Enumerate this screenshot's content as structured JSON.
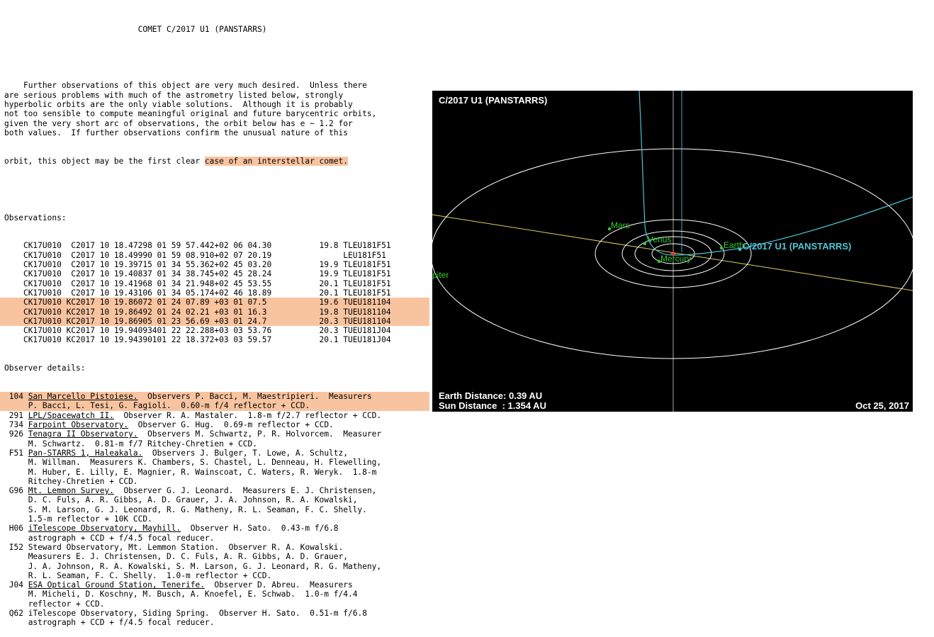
{
  "document": {
    "title": "COMET C/2017 U1 (PANSTARRS)",
    "paragraph": [
      "Further observations of this object are very much desired.  Unless there",
      "are serious problems with much of the astrometry listed below, strongly",
      "hyperbolic orbits are the only viable solutions.  Although it is probably",
      "not too sensible to compute meaningful original and future barycentric orbits,",
      "given the very short arc of observations, the orbit below has e ~ 1.2 for",
      "both values.  If further observations confirm the unusual nature of this"
    ],
    "paragraph_last_prefix": "orbit, this object may be the first clear ",
    "paragraph_last_highlight": "case of an interstellar comet.",
    "observations_heading": "Observations:",
    "observations": [
      "CK17U010  C2017 10 18.47298 01 59 57.442+02 06 04.30          19.8 TLEU181F51",
      "CK17U010  C2017 10 18.49990 01 59 08.910+02 07 20.19               LEU181F51",
      "CK17U010  C2017 10 19.39715 01 34 55.362+02 45 03.20          19.9 TLEU181F51",
      "CK17U010  C2017 10 19.40837 01 34 38.745+02 45 28.24          19.9 TLEU181F51",
      "CK17U010  C2017 10 19.41968 01 34 21.948+02 45 53.55          20.1 TLEU181F51",
      "CK17U010  C2017 10 19.43106 01 34 05.174+02 46 18.89          20.1 TLEU181F51",
      "CK17U010 KC2017 10 19.86072 01 24 07.89 +03 01 07.5           19.6 TUEU181104",
      "CK17U010 KC2017 10 19.86492 01 24 02.21 +03 01 16.3           19.8 TUEU181104",
      "CK17U010 KC2017 10 19.86905 01 23 56.69 +03 01 24.7           20.3 TUEU181104",
      "CK17U010 KC2017 10 19.94093401 22 22.288+03 03 53.76          20.3 TUEU181J04",
      "CK17U010 KC2017 10 19.94390101 22 18.372+03 03 59.57          20.1 TUEU181J04"
    ],
    "observer_heading": "Observer details:",
    "observers": [
      {
        "code": "104",
        "site": "San Marcello Pistoiese.",
        "text": "  Observers P. Bacci, M. Maestripieri.  Measurers",
        "cont": [
          "P. Bacci, L. Tesi, G. Fagioli.  0.60-m f/4 reflector + CCD."
        ]
      },
      {
        "code": "291",
        "site": "LPL/Spacewatch II.",
        "text": "  Observer R. A. Mastaler.  1.8-m f/2.7 reflector + CCD.",
        "cont": []
      },
      {
        "code": "734",
        "site": "Farpoint Observatory.",
        "text": "  Observer G. Hug.  0.69-m reflector + CCD.",
        "cont": []
      },
      {
        "code": "926",
        "site": "Tenagra II Observatory.",
        "text": "  Observers M. Schwartz, P. R. Holvorcem.  Measurer",
        "cont": [
          "M. Schwartz.  0.81-m f/7 Ritchey-Chretien + CCD."
        ]
      },
      {
        "code": "F51",
        "site": "Pan-STARRS 1, Haleakala.",
        "text": "  Observers J. Bulger, T. Lowe, A. Schultz,",
        "cont": [
          "M. Willman.  Measurers K. Chambers, S. Chastel, L. Denneau, H. Flewelling,",
          "M. Huber, E. Lilly, E. Magnier, R. Wainscoat, C. Waters, R. Weryk.  1.8-m",
          "Ritchey-Chretien + CCD."
        ]
      },
      {
        "code": "G96",
        "site": "Mt. Lemmon Survey.",
        "text": "  Observer G. J. Leonard.  Measurers E. J. Christensen,",
        "cont": [
          "D. C. Fuls, A. R. Gibbs, A. D. Grauer, J. A. Johnson, R. A. Kowalski,",
          "S. M. Larson, G. J. Leonard, R. G. Matheny, R. L. Seaman, F. C. Shelly.",
          "1.5-m reflector + 10K CCD."
        ]
      },
      {
        "code": "H06",
        "site": "iTelescope Observatory, Mayhill.",
        "text": "  Observer H. Sato.  0.43-m f/6.8",
        "cont": [
          "astrograph + CCD + f/4.5 focal reducer."
        ]
      },
      {
        "code": "I52",
        "site": "",
        "text": "Steward Observatory, Mt. Lemmon Station.  Observer R. A. Kowalski.",
        "cont": [
          "Measurers E. J. Christensen, D. C. Fuls, A. R. Gibbs, A. D. Grauer,",
          "J. A. Johnson, R. A. Kowalski, S. M. Larson, G. J. Leonard, R. G. Matheny,",
          "R. L. Seaman, F. C. Shelly.  1.0-m reflector + CCD."
        ]
      },
      {
        "code": "J04",
        "site": "ESA Optical Ground Station, Tenerife.",
        "text": "  Observer D. Abreu.  Measurers",
        "cont": [
          "M. Micheli, D. Koschny, M. Busch, A. Knoefel, E. Schwab.  1.0-m f/4.4",
          "reflector + CCD."
        ]
      },
      {
        "code": "Q62",
        "site": "",
        "text": "iTelescope Observatory, Siding Spring.  Observer H. Sato.  0.51-m f/6.8",
        "cont": [
          "astrograph + CCD + f/4.5 focal reducer."
        ]
      }
    ]
  },
  "orbit_view": {
    "title": "C/2017 U1 (PANSTARRS)",
    "comet_label": "C/2017 U1 (PANSTARRS)",
    "planets": [
      "Mars",
      "Venus",
      "Earth",
      "Mercury",
      "Jupiter"
    ],
    "planet_labels_shown": {
      "Mars": "Mars",
      "Venus": "Venus",
      "Earth": "Earth",
      "Mercury": "Mercury",
      "Jupiter": "piter"
    },
    "earth_distance": "Earth Distance: 0.39 AU",
    "sun_distance": "Sun Distance  : 1.354 AU",
    "date": "Oct 25, 2017",
    "colors": {
      "background": "#000000",
      "orbits": "#ffffff",
      "comet": "#4fc3d6",
      "planet": "#33cc33",
      "sun": "#ff3333",
      "ecliptic": "#d8d060"
    }
  }
}
